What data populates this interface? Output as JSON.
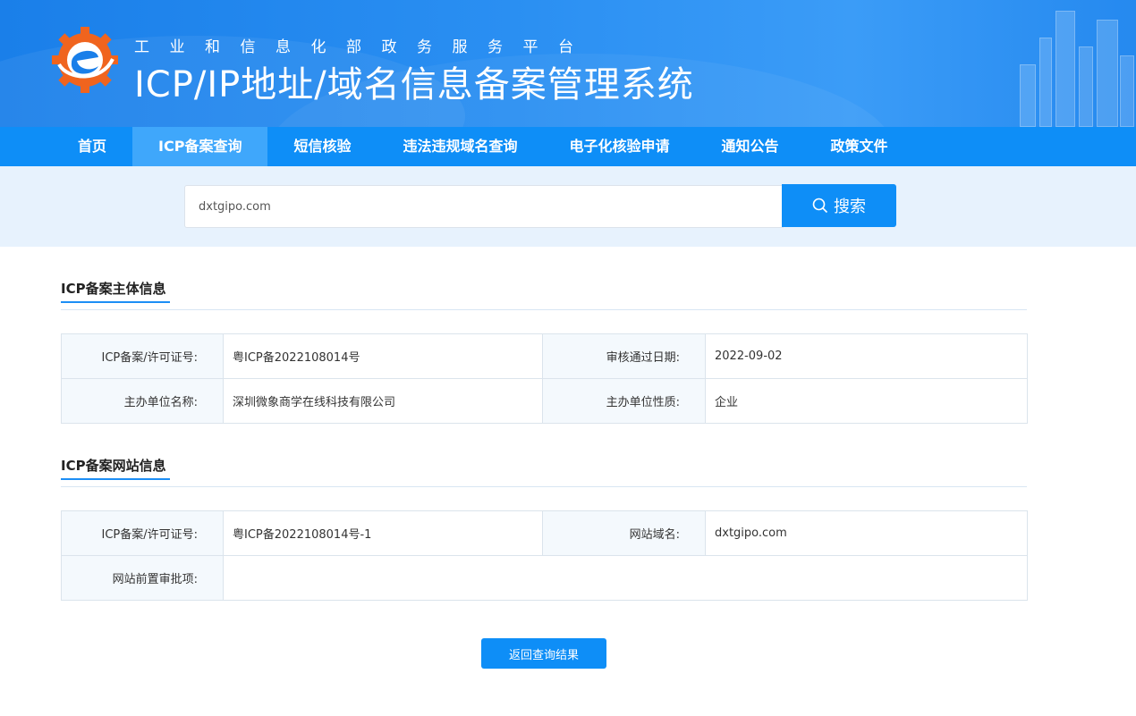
{
  "header": {
    "subtitle": "工业和信息化部政务服务平台",
    "title": "ICP/IP地址/域名信息备案管理系统"
  },
  "nav": {
    "items": [
      {
        "label": "首页",
        "active": false
      },
      {
        "label": "ICP备案查询",
        "active": true
      },
      {
        "label": "短信核验",
        "active": false
      },
      {
        "label": "违法违规域名查询",
        "active": false
      },
      {
        "label": "电子化核验申请",
        "active": false
      },
      {
        "label": "通知公告",
        "active": false
      },
      {
        "label": "政策文件",
        "active": false
      }
    ]
  },
  "search": {
    "value": "dxtgipo.com",
    "button_label": "搜索",
    "button_icon": "search-icon"
  },
  "subject_info": {
    "section_title": "ICP备案主体信息",
    "license_label": "ICP备案/许可证号:",
    "license_value": "粤ICP备2022108014号",
    "approval_date_label": "审核通过日期:",
    "approval_date_value": "2022-09-02",
    "org_name_label": "主办单位名称:",
    "org_name_value": "深圳微象商学在线科技有限公司",
    "org_type_label": "主办单位性质:",
    "org_type_value": "企业"
  },
  "website_info": {
    "section_title": "ICP备案网站信息",
    "license_label": "ICP备案/许可证号:",
    "license_value": "粤ICP备2022108014号-1",
    "domain_label": "网站域名:",
    "domain_value": "dxtgipo.com",
    "preapproval_label": "网站前置审批项:",
    "preapproval_value": ""
  },
  "actions": {
    "back_label": "返回查询结果"
  },
  "colors": {
    "primary": "#0e8ef7",
    "nav_active": "#3fa7fb",
    "search_band": "#e7f2fd",
    "label_bg": "#f4f9fd",
    "logo_orange": "#f0641e"
  }
}
